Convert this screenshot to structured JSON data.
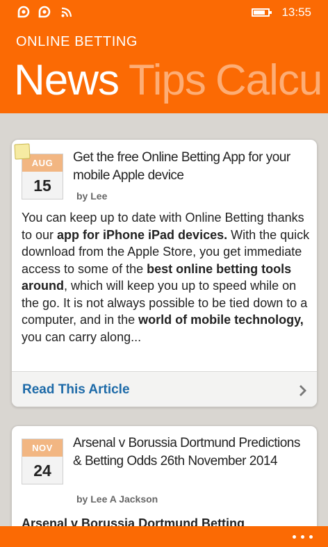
{
  "status_bar": {
    "time": "13:55",
    "icons": [
      "notification-icon",
      "notification-icon",
      "wifi-icon",
      "battery-icon"
    ]
  },
  "app": {
    "title": "ONLINE BETTING"
  },
  "pivot": {
    "items": [
      {
        "label": "News",
        "active": true
      },
      {
        "label": "Tips",
        "active": false
      },
      {
        "label": "Calcu",
        "active": false
      }
    ]
  },
  "articles": [
    {
      "month": "AUG",
      "day": "15",
      "title": "Get the free Online Betting App for your mobile Apple device",
      "author": "by Lee",
      "body": [
        {
          "text": "You can keep up to date with Online Betting thanks to our ",
          "bold": false
        },
        {
          "text": "app for iPhone iPad devices.",
          "bold": true
        },
        {
          "text": " With the quick download from the Apple Store, you get immediate access to some of the ",
          "bold": false
        },
        {
          "text": "best online betting tools around",
          "bold": true
        },
        {
          "text": ", which will keep you up to speed while on the go. It is not always possible to be tied down to a computer, and in the ",
          "bold": false
        },
        {
          "text": "world of mobile technology,",
          "bold": true
        },
        {
          "text": " you can carry along...",
          "bold": false
        }
      ],
      "read_more": "Read This Article"
    },
    {
      "month": "NOV",
      "day": "24",
      "title": "Arsenal v Borussia Dortmund Predictions & Betting Odds 26th November 2014",
      "author": "by Lee A Jackson",
      "body": [
        {
          "text": "Arsenal v Borussia Dortmund Betting",
          "bold": true
        }
      ]
    }
  ],
  "app_bar": {
    "more_icon": "ellipsis-icon"
  },
  "colors": {
    "accent": "#fb6a04",
    "link": "#1d6aa8",
    "month_badge": "#f2b682",
    "background": "#d9d6d1"
  }
}
